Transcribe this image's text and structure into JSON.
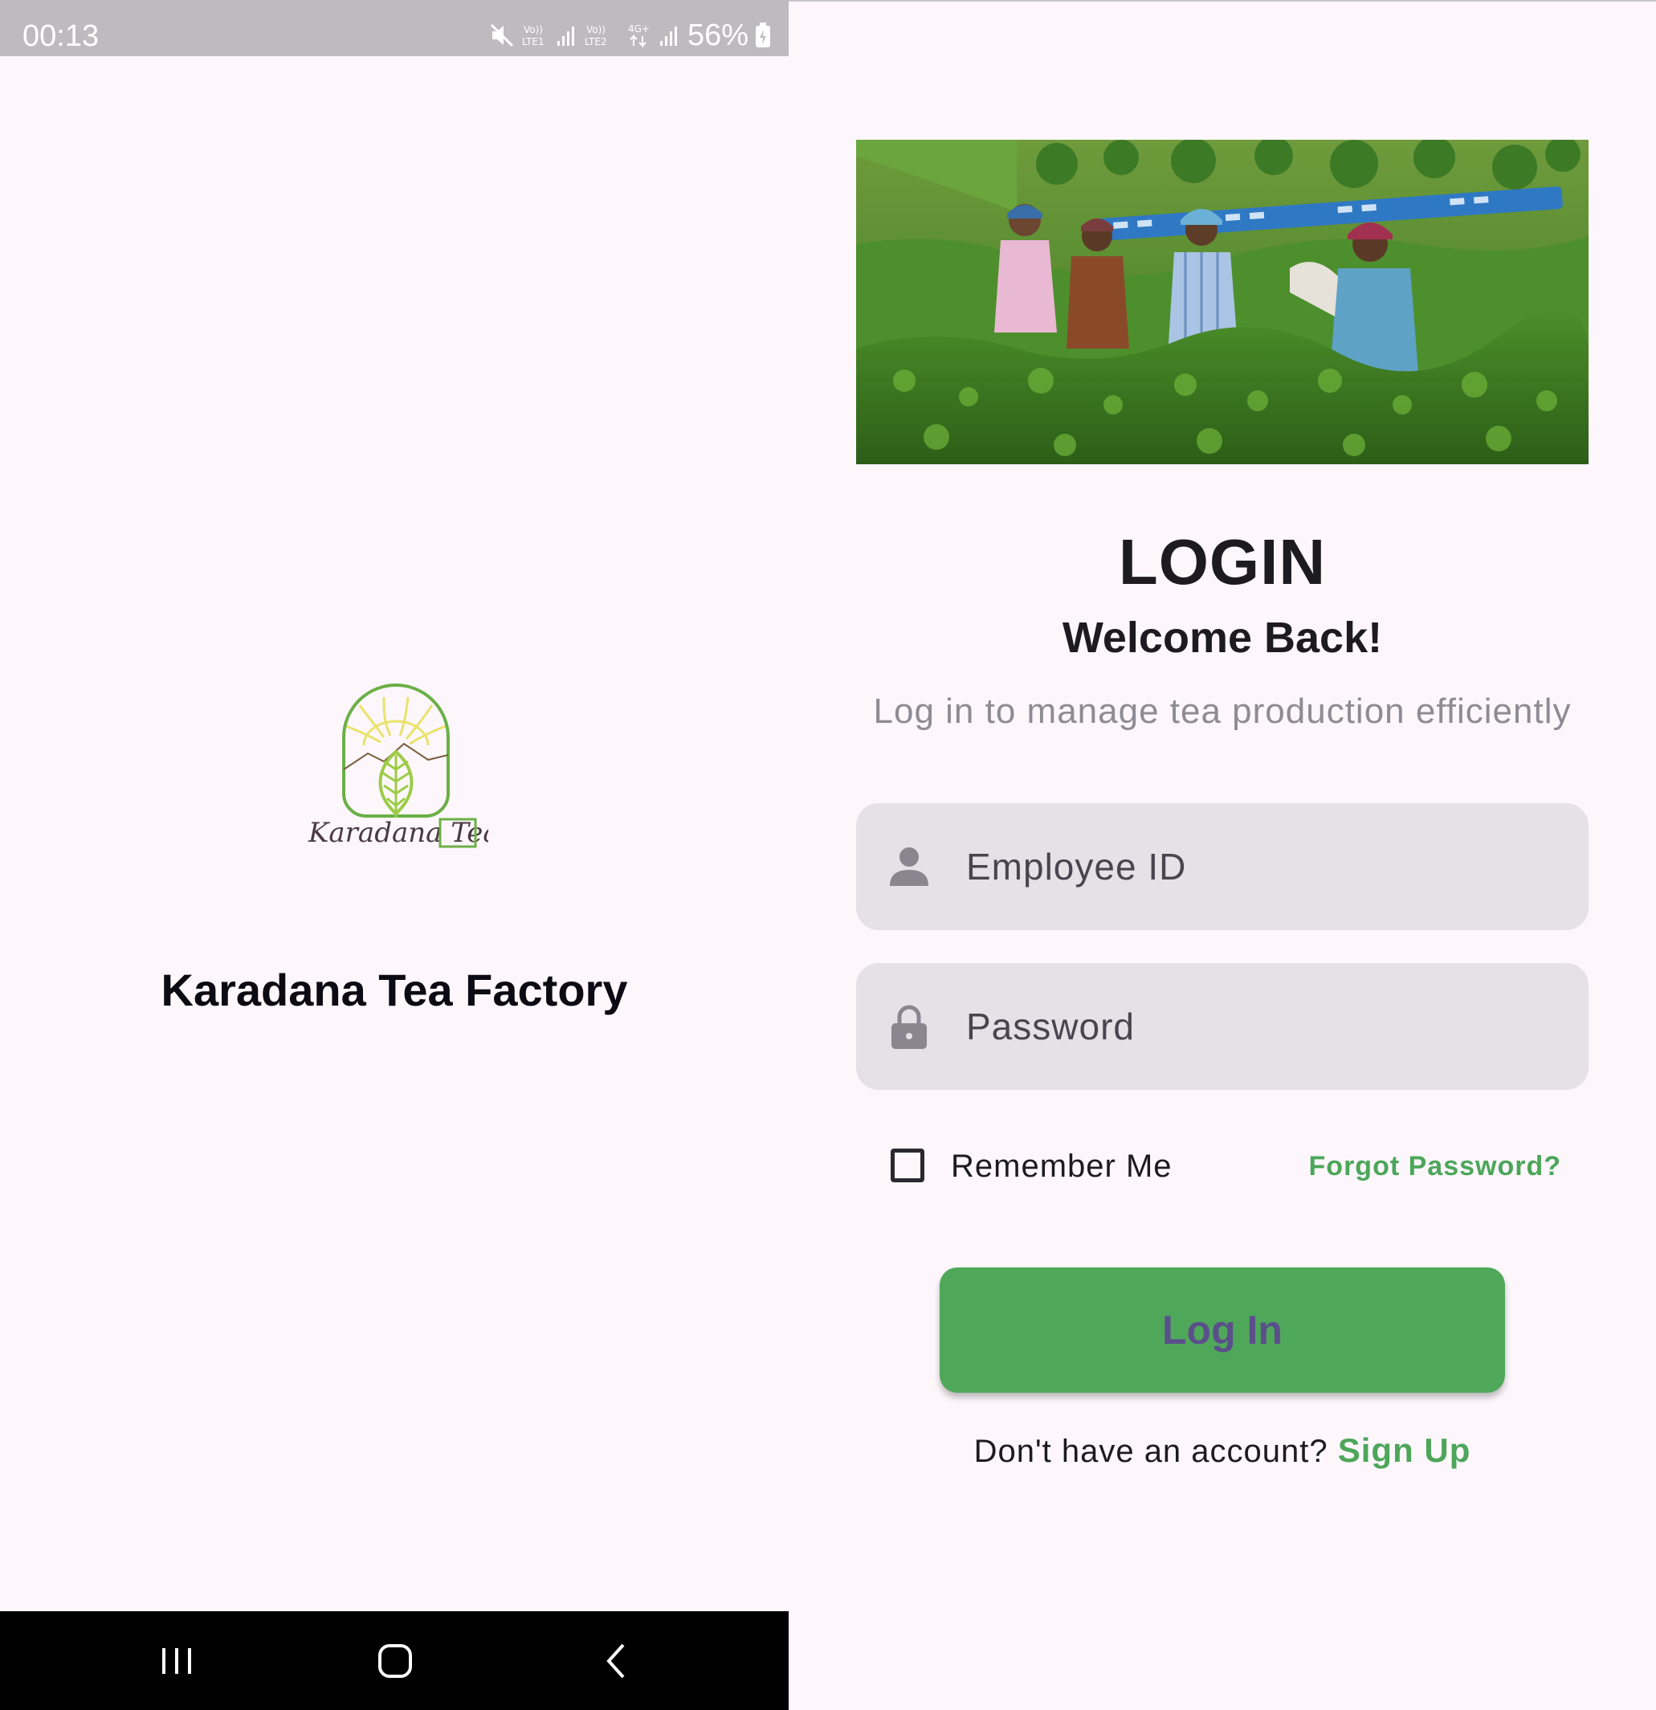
{
  "status_bar": {
    "time": "00:13",
    "network_1": "Vo)) LTE1",
    "network_2": "Vo)) LTE2",
    "network_type": "4G+",
    "battery": "56%"
  },
  "splash": {
    "logo_script": "Karadana Tea",
    "app_name": "Karadana Tea Factory"
  },
  "navigation_bar": {
    "recents": "recents-icon",
    "home": "home-icon",
    "back": "back-icon"
  },
  "login": {
    "title": "LOGIN",
    "welcome": "Welcome Back!",
    "subtitle": "Log in to manage tea production efficiently",
    "employee_id_placeholder": "Employee ID",
    "password_placeholder": "Password",
    "remember_me": "Remember Me",
    "forgot_password": "Forgot Password?",
    "login_button": "Log In",
    "no_account": "Don't have an account?",
    "sign_up": "Sign Up"
  },
  "colors": {
    "background": "#fdf7fc",
    "accent_green": "#4fa85a",
    "button_text": "#5b4f8a",
    "field_bg": "#e6e0e7"
  }
}
